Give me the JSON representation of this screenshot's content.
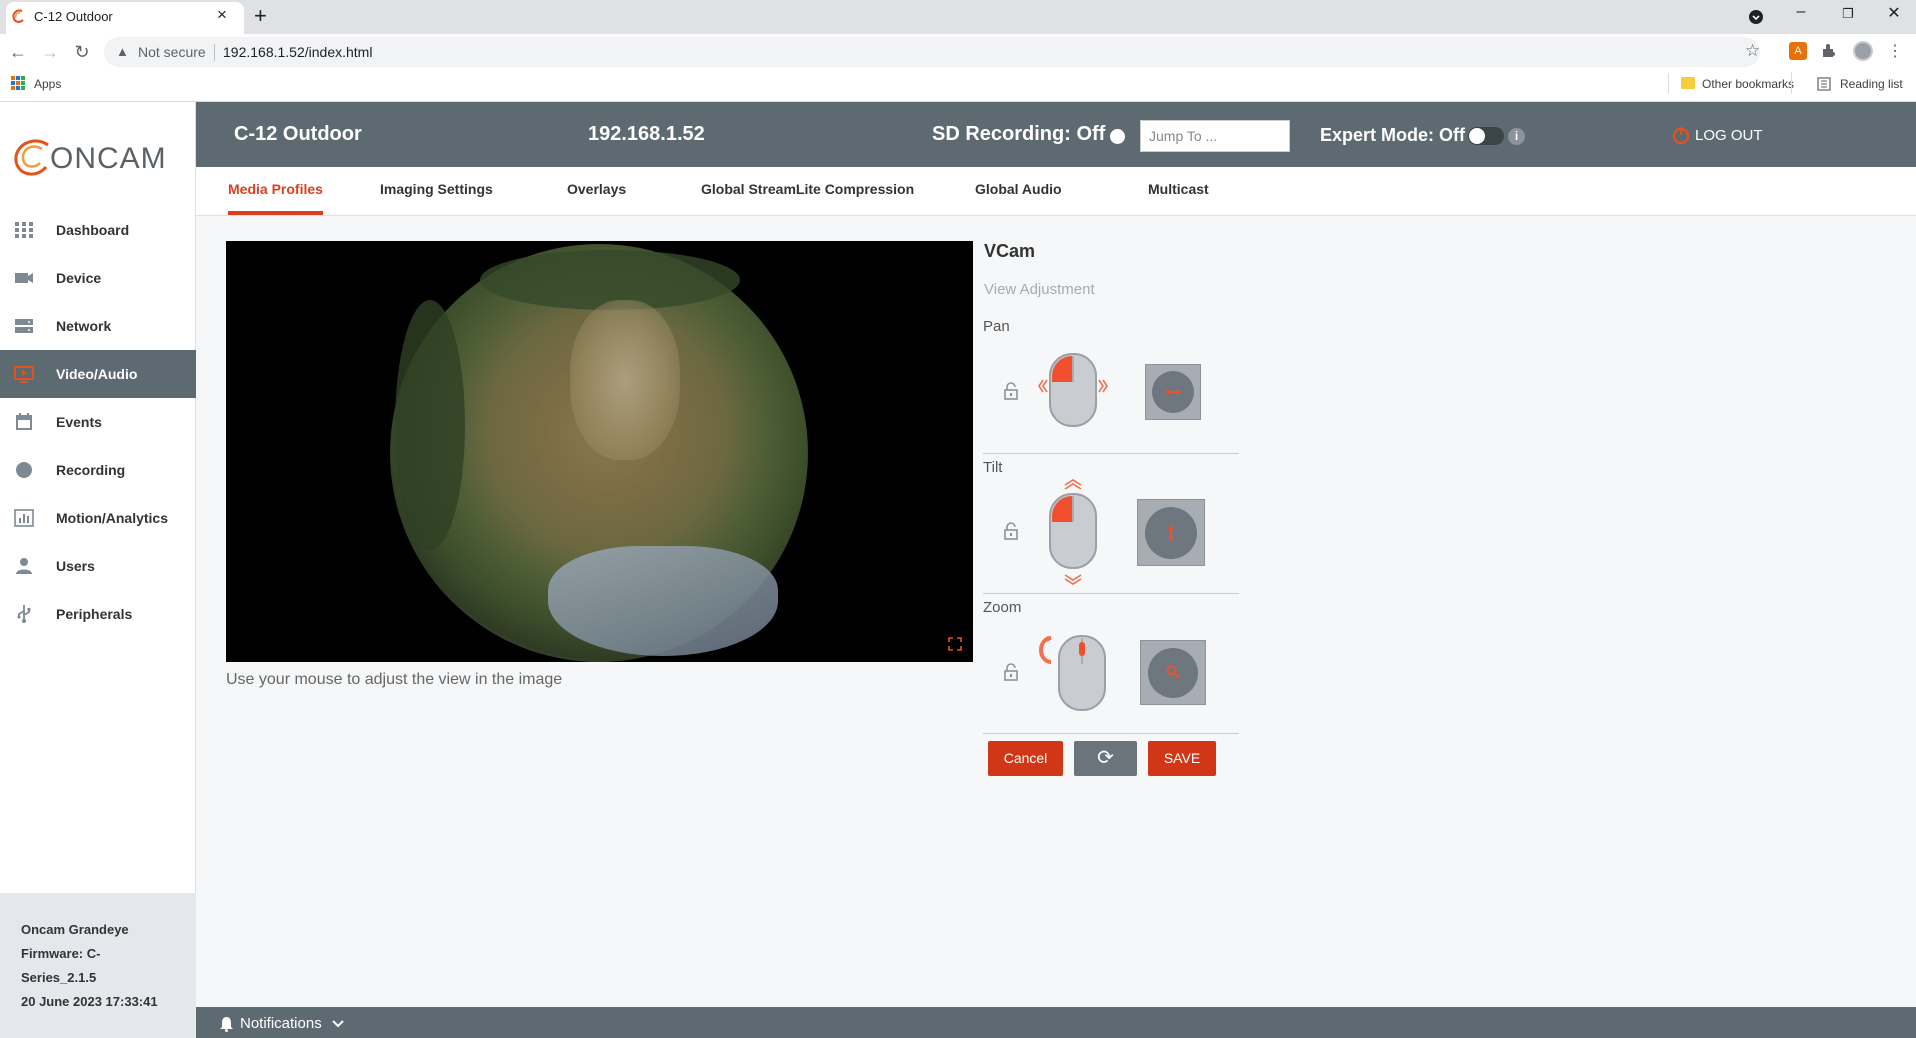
{
  "browser": {
    "tab_title": "C-12 Outdoor",
    "new_tab": "+",
    "close_tab": "×",
    "security_label": "Not secure",
    "url": "192.168.1.52/index.html",
    "bookmarks": {
      "apps": "Apps",
      "other": "Other bookmarks",
      "reading": "Reading list"
    },
    "ext_letter": "A"
  },
  "header": {
    "camera_name": "C-12 Outdoor",
    "ip": "192.168.1.52",
    "sd_recording": "SD Recording: Off",
    "jump_placeholder": "Jump To ...",
    "expert_mode": "Expert Mode: Off",
    "info": "i",
    "logout": "LOG OUT"
  },
  "brand": {
    "logo_text": "ONCAM"
  },
  "sidebar": {
    "items": [
      {
        "label": "Dashboard",
        "icon": "grid-icon"
      },
      {
        "label": "Device",
        "icon": "camera-icon"
      },
      {
        "label": "Network",
        "icon": "network-icon"
      },
      {
        "label": "Video/Audio",
        "icon": "video-icon",
        "active": true
      },
      {
        "label": "Events",
        "icon": "calendar-icon"
      },
      {
        "label": "Recording",
        "icon": "record-icon"
      },
      {
        "label": "Motion/Analytics",
        "icon": "chart-icon"
      },
      {
        "label": "Users",
        "icon": "user-icon"
      },
      {
        "label": "Peripherals",
        "icon": "usb-icon"
      }
    ],
    "footer": {
      "model": "Oncam Grandeye",
      "firmware_line1": "Firmware: C-",
      "firmware_line2": "Series_2.1.5",
      "datetime": "20 June 2023 17:33:41"
    }
  },
  "tabs": [
    {
      "label": "Media Profiles",
      "active": true
    },
    {
      "label": "Imaging Settings"
    },
    {
      "label": "Overlays"
    },
    {
      "label": "Global StreamLite Compression"
    },
    {
      "label": "Global Audio"
    },
    {
      "label": "Multicast"
    }
  ],
  "video": {
    "hint": "Use your mouse to adjust the view in the image"
  },
  "vcam": {
    "title": "VCam",
    "subtitle": "View Adjustment",
    "pan": "Pan",
    "tilt": "Tilt",
    "zoom": "Zoom",
    "cancel": "Cancel",
    "reset": "⟳",
    "save": "SAVE"
  },
  "notifications": {
    "label": "Notifications"
  },
  "colors": {
    "accent": "#d13717",
    "header": "#5e6a71"
  }
}
